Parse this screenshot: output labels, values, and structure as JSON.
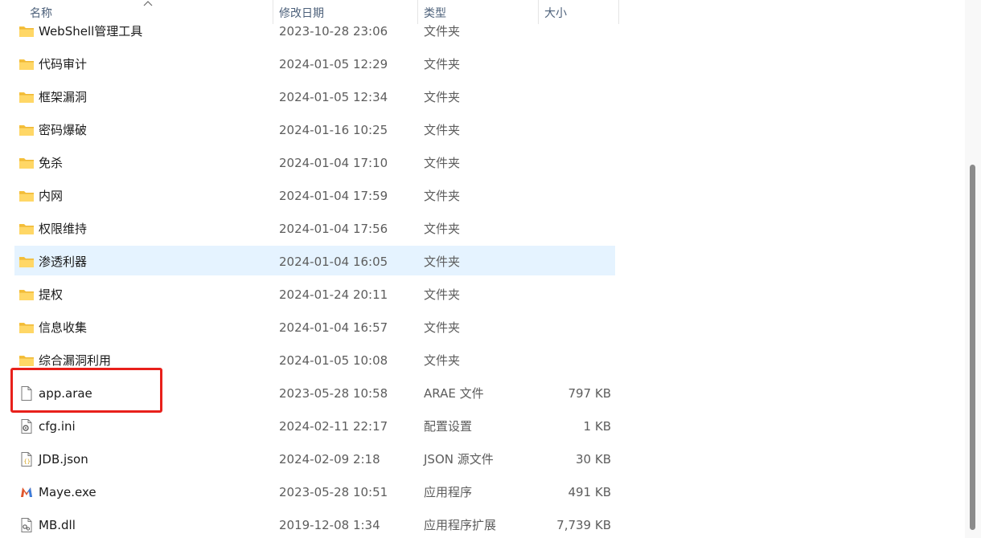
{
  "columns": {
    "name": "名称",
    "date": "修改日期",
    "type": "类型",
    "size": "大小"
  },
  "files": [
    {
      "name": "WebShell管理工具",
      "date": "2023-10-28 23:06",
      "type": "文件夹",
      "size": "",
      "icon": "folder-icon"
    },
    {
      "name": "代码审计",
      "date": "2024-01-05 12:29",
      "type": "文件夹",
      "size": "",
      "icon": "folder-icon"
    },
    {
      "name": "框架漏洞",
      "date": "2024-01-05 12:34",
      "type": "文件夹",
      "size": "",
      "icon": "folder-icon"
    },
    {
      "name": "密码爆破",
      "date": "2024-01-16 10:25",
      "type": "文件夹",
      "size": "",
      "icon": "folder-icon"
    },
    {
      "name": "免杀",
      "date": "2024-01-04 17:10",
      "type": "文件夹",
      "size": "",
      "icon": "folder-icon"
    },
    {
      "name": "内网",
      "date": "2024-01-04 17:59",
      "type": "文件夹",
      "size": "",
      "icon": "folder-icon"
    },
    {
      "name": "权限维持",
      "date": "2024-01-04 17:56",
      "type": "文件夹",
      "size": "",
      "icon": "folder-icon"
    },
    {
      "name": "渗透利器",
      "date": "2024-01-04 16:05",
      "type": "文件夹",
      "size": "",
      "icon": "folder-icon",
      "selected": true
    },
    {
      "name": "提权",
      "date": "2024-01-24 20:11",
      "type": "文件夹",
      "size": "",
      "icon": "folder-icon"
    },
    {
      "name": "信息收集",
      "date": "2024-01-04 16:57",
      "type": "文件夹",
      "size": "",
      "icon": "folder-icon"
    },
    {
      "name": "综合漏洞利用",
      "date": "2024-01-05 10:08",
      "type": "文件夹",
      "size": "",
      "icon": "folder-icon"
    },
    {
      "name": "app.arae",
      "date": "2023-05-28 10:58",
      "type": "ARAE 文件",
      "size": "797 KB",
      "icon": "file-icon"
    },
    {
      "name": "cfg.ini",
      "date": "2024-02-11 22:17",
      "type": "配置设置",
      "size": "1 KB",
      "icon": "settings-file-icon"
    },
    {
      "name": "JDB.json",
      "date": "2024-02-09 2:18",
      "type": "JSON 源文件",
      "size": "30 KB",
      "icon": "json-file-icon"
    },
    {
      "name": "Maye.exe",
      "date": "2023-05-28 10:51",
      "type": "应用程序",
      "size": "491 KB",
      "icon": "maye-app-icon"
    },
    {
      "name": "MB.dll",
      "date": "2019-12-08 1:34",
      "type": "应用程序扩展",
      "size": "7,739 KB",
      "icon": "dll-file-icon"
    }
  ],
  "colors": {
    "selected_row": "#e5f3ff",
    "highlight_box": "#e8201b",
    "folder": "#f5c03b"
  }
}
